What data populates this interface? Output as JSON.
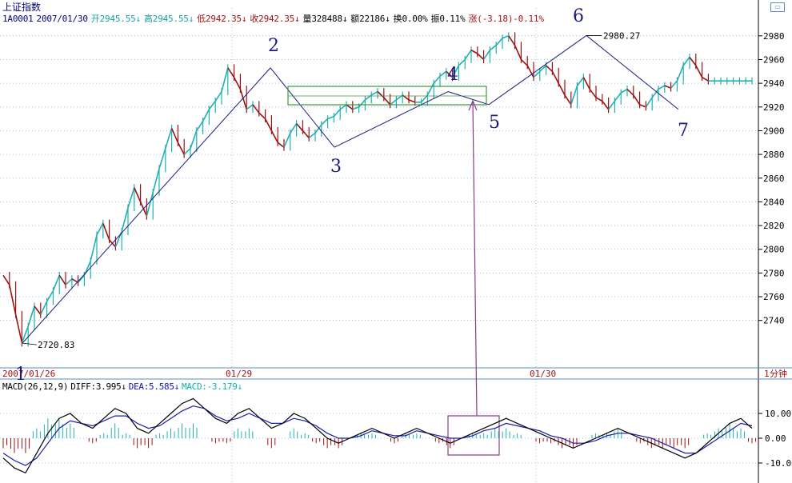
{
  "header": {
    "index_name": "上证指数",
    "code": "1A0001",
    "date": "2007/01/30",
    "open": "开2945.55↓",
    "high": "高2945.55↓",
    "low": "低2942.35↓",
    "close": "收2942.35↓",
    "volume": "量328488↓",
    "amount": "额22186↓",
    "turnover": "换0.00%",
    "amplitude": "振0.11%",
    "change": "涨(-3.18)-0.11%"
  },
  "macd_bar": {
    "params": "MACD(26,12,9)",
    "diff": "DIFF:3.995↓",
    "dea": "DEA:5.585↓",
    "macd": "MACD:-3.179↓"
  },
  "corner_icon": "window-restore-icon",
  "colors": {
    "up": "#20b0b0",
    "down": "#a01010",
    "grid": "#8fb0d4",
    "wave_line": "#1a1a80",
    "rect": "#3a9a3a",
    "magenta": "#8a3a8a"
  },
  "chart_data": [
    {
      "type": "line",
      "title": "上证指数",
      "ylim": [
        2700,
        2990
      ],
      "yticks": [
        2740,
        2760,
        2780,
        2800,
        2820,
        2840,
        2860,
        2880,
        2900,
        2920,
        2940,
        2960,
        2980
      ],
      "x_labels": [
        "2007/01/26",
        "01/29",
        "01/30"
      ],
      "series": [
        {
          "x": [
            0,
            2,
            4,
            6,
            8,
            10,
            12,
            14,
            16,
            18,
            20,
            22,
            24,
            26,
            28,
            30,
            32,
            34,
            36,
            38,
            40,
            42,
            44,
            46,
            48,
            50,
            52,
            54,
            56,
            58,
            60,
            62,
            64,
            66,
            68,
            70,
            72,
            74,
            76,
            78,
            80,
            82,
            84,
            86,
            88,
            90,
            92,
            94,
            96,
            98,
            100,
            102,
            104,
            106,
            108,
            110,
            112,
            114,
            116,
            118,
            120,
            122,
            124,
            126,
            128,
            130,
            132,
            134,
            136,
            138,
            140,
            142,
            144,
            146,
            148,
            150,
            152,
            154,
            156,
            158,
            160,
            162,
            164,
            166,
            168,
            170,
            172,
            174,
            176,
            178,
            180,
            182,
            184,
            186,
            188,
            190,
            192,
            194,
            196,
            198,
            200,
            202,
            204,
            206,
            208,
            210,
            212,
            214,
            216,
            218,
            220,
            222,
            224,
            226,
            228,
            230,
            232,
            234,
            236,
            238,
            240
          ],
          "values": [
            2778,
            2770,
            2745,
            2721,
            2735,
            2752,
            2745,
            2756,
            2765,
            2778,
            2770,
            2775,
            2772,
            2778,
            2790,
            2812,
            2822,
            2808,
            2802,
            2815,
            2835,
            2852,
            2840,
            2828,
            2848,
            2868,
            2885,
            2902,
            2890,
            2880,
            2885,
            2900,
            2908,
            2918,
            2925,
            2933,
            2953,
            2945,
            2935,
            2918,
            2922,
            2915,
            2910,
            2900,
            2890,
            2886,
            2898,
            2906,
            2900,
            2894,
            2898,
            2905,
            2910,
            2912,
            2918,
            2922,
            2918,
            2920,
            2926,
            2930,
            2933,
            2928,
            2922,
            2926,
            2930,
            2926,
            2924,
            2924,
            2930,
            2940,
            2946,
            2950,
            2945,
            2955,
            2960,
            2968,
            2965,
            2960,
            2968,
            2972,
            2978,
            2980,
            2972,
            2960,
            2955,
            2945,
            2950,
            2955,
            2950,
            2940,
            2930,
            2922,
            2938,
            2945,
            2935,
            2928,
            2925,
            2918,
            2925,
            2932,
            2935,
            2930,
            2922,
            2920,
            2928,
            2935,
            2938,
            2936,
            2942,
            2955,
            2962,
            2955,
            2945,
            2942,
            2942,
            2942,
            2942,
            2942,
            2942,
            2942,
            2942
          ]
        }
      ],
      "wave_points": [
        {
          "label": "1",
          "value": 2720.83
        },
        {
          "label": "2",
          "value": 2953
        },
        {
          "label": "3",
          "value": 2886
        },
        {
          "label": "4",
          "value": 2933
        },
        {
          "label": "5",
          "value": 2922
        },
        {
          "label": "6",
          "value": 2980.27
        },
        {
          "label": "7",
          "value": 2918
        }
      ],
      "annotations": [
        "2720.83",
        "2980.27"
      ]
    },
    {
      "type": "bar",
      "title": "MACD(26,12,9)",
      "ylim": [
        -16,
        16
      ],
      "yticks": [
        10.0,
        0.0,
        -10.0
      ],
      "series": [
        {
          "name": "DIFF",
          "values": [
            -8,
            -12,
            -14,
            -6,
            2,
            8,
            10,
            6,
            4,
            8,
            12,
            10,
            4,
            2,
            6,
            10,
            14,
            16,
            12,
            8,
            6,
            10,
            12,
            8,
            4,
            6,
            10,
            8,
            4,
            0,
            -2,
            0,
            2,
            4,
            2,
            0,
            2,
            4,
            2,
            0,
            -2,
            0,
            2,
            4,
            6,
            8,
            6,
            4,
            2,
            0,
            -2,
            -4,
            -2,
            0,
            2,
            4,
            2,
            0,
            -2,
            -4,
            -6,
            -8,
            -6,
            -2,
            2,
            6,
            8,
            4
          ]
        },
        {
          "name": "DEA",
          "values": [
            -6,
            -9,
            -11,
            -8,
            -2,
            4,
            7,
            6,
            5,
            7,
            9,
            9,
            6,
            4,
            5,
            8,
            11,
            13,
            12,
            9,
            7,
            8,
            10,
            8,
            6,
            6,
            8,
            7,
            5,
            2,
            0,
            0,
            1,
            3,
            2,
            1,
            1,
            3,
            2,
            1,
            0,
            0,
            1,
            3,
            4,
            6,
            5,
            4,
            3,
            1,
            0,
            -2,
            -2,
            -1,
            1,
            2,
            2,
            1,
            0,
            -2,
            -4,
            -6,
            -6,
            -3,
            0,
            3,
            6,
            5
          ]
        }
      ]
    }
  ]
}
